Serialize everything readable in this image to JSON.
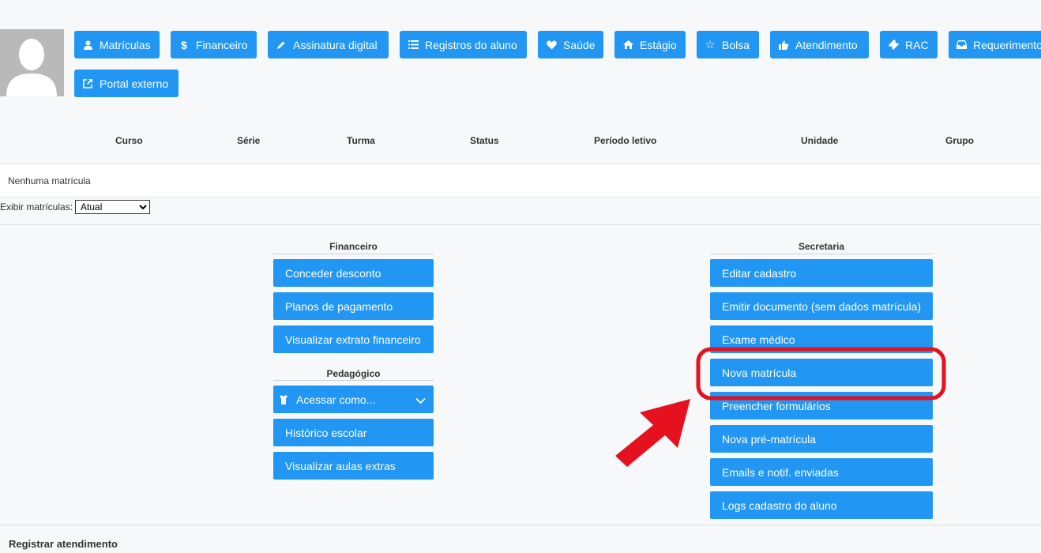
{
  "toolbar": {
    "buttons": [
      {
        "label": "Matrículas",
        "icon": "user-icon"
      },
      {
        "label": "Financeiro",
        "icon": "dollar-icon"
      },
      {
        "label": "Assinatura digital",
        "icon": "pencil-icon"
      },
      {
        "label": "Registros do aluno",
        "icon": "list-icon"
      },
      {
        "label": "Saúde",
        "icon": "heart-icon"
      },
      {
        "label": "Estágio",
        "icon": "home-icon"
      },
      {
        "label": "Bolsa",
        "icon": "star-icon"
      },
      {
        "label": "Atendimento",
        "icon": "thumbs-up-icon"
      },
      {
        "label": "RAC",
        "icon": "ticket-icon"
      },
      {
        "label": "Requerimento",
        "icon": "inbox-icon"
      },
      {
        "label": "Portal externo",
        "icon": "external-link-icon"
      }
    ]
  },
  "table": {
    "headers": [
      "Curso",
      "Série",
      "Turma",
      "Status",
      "Período letivo",
      "Unidade",
      "Grupo"
    ],
    "empty_text": "Nenhuma matrícula"
  },
  "filter": {
    "label": "Exibir matrículas:",
    "selected": "Atual"
  },
  "financeiro": {
    "title": "Financeiro",
    "items": [
      "Conceder desconto",
      "Planos de pagamento",
      "Visualizar extrato financeiro"
    ]
  },
  "pedagogico": {
    "title": "Pedagógico",
    "items": [
      "Acessar como...",
      "Histórico escolar",
      "Visualizar aulas extras"
    ]
  },
  "secretaria": {
    "title": "Secretaria",
    "items": [
      "Editar cadastro",
      "Emitir documento (sem dados matrícula)",
      "Exame médico",
      "Nova matrícula",
      "Preencher formulários",
      "Nova pré-matrícula",
      "Emails e notif. enviadas",
      "Logs cadastro do aluno"
    ]
  },
  "footer": {
    "title": "Registrar atendimento"
  },
  "colors": {
    "accent": "#2196f3",
    "highlight": "#e5111f",
    "background": "#f7f8fa"
  }
}
